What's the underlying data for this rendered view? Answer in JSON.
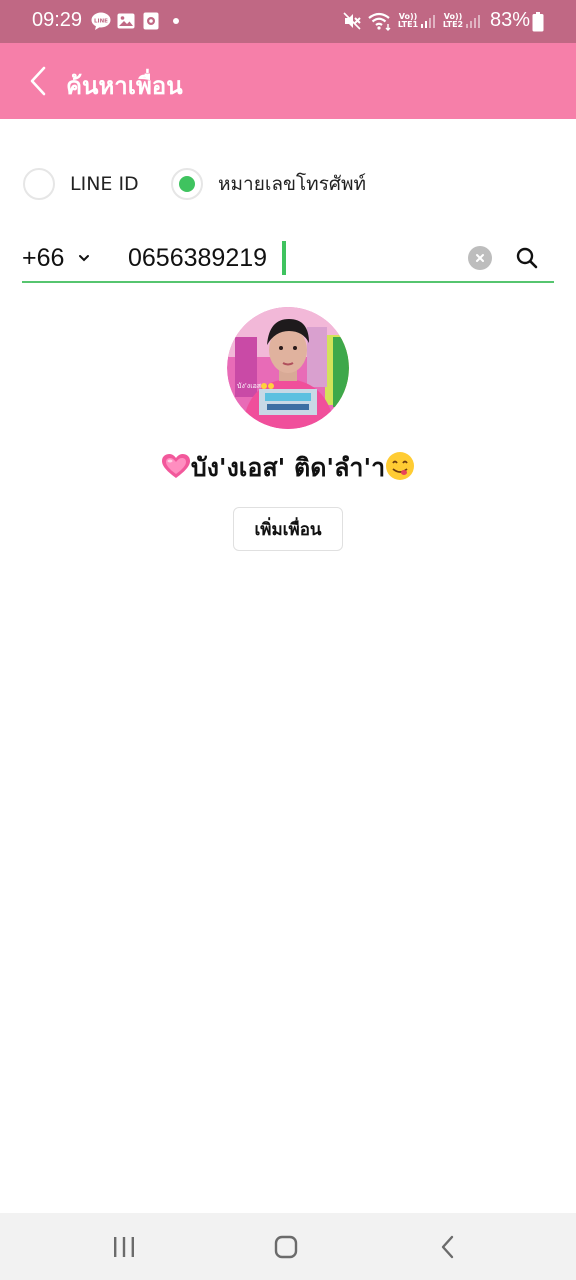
{
  "status_bar": {
    "time": "09:29",
    "battery": "83%",
    "sim1_label_top": "Vo))",
    "sim1_label_bottom": "LTE1",
    "sim2_label_top": "Vo))",
    "sim2_label_bottom": "LTE2",
    "icons": [
      "line-icon",
      "gallery-icon",
      "screen-recorder-icon",
      "dot-icon",
      "mute-icon",
      "wifi-icon",
      "signal-icon",
      "battery-icon"
    ]
  },
  "header": {
    "title": "ค้นหาเพื่อน",
    "background": "#f67fa9"
  },
  "search_type": {
    "options": [
      {
        "label": "LINE ID",
        "selected": false
      },
      {
        "label": "หมายเลขโทรศัพท์",
        "selected": true
      }
    ],
    "accent": "#3fc35f"
  },
  "phone_search": {
    "country_code": "+66",
    "value": "0656389219"
  },
  "result": {
    "name": "บัง'งเอส' ติด'ลำ'า",
    "add_button": "เพิ่มเพื่อน",
    "avatar_caption": "บัง'งเอส"
  },
  "nav_bar": {
    "buttons": [
      "recent-apps",
      "home",
      "back"
    ]
  }
}
